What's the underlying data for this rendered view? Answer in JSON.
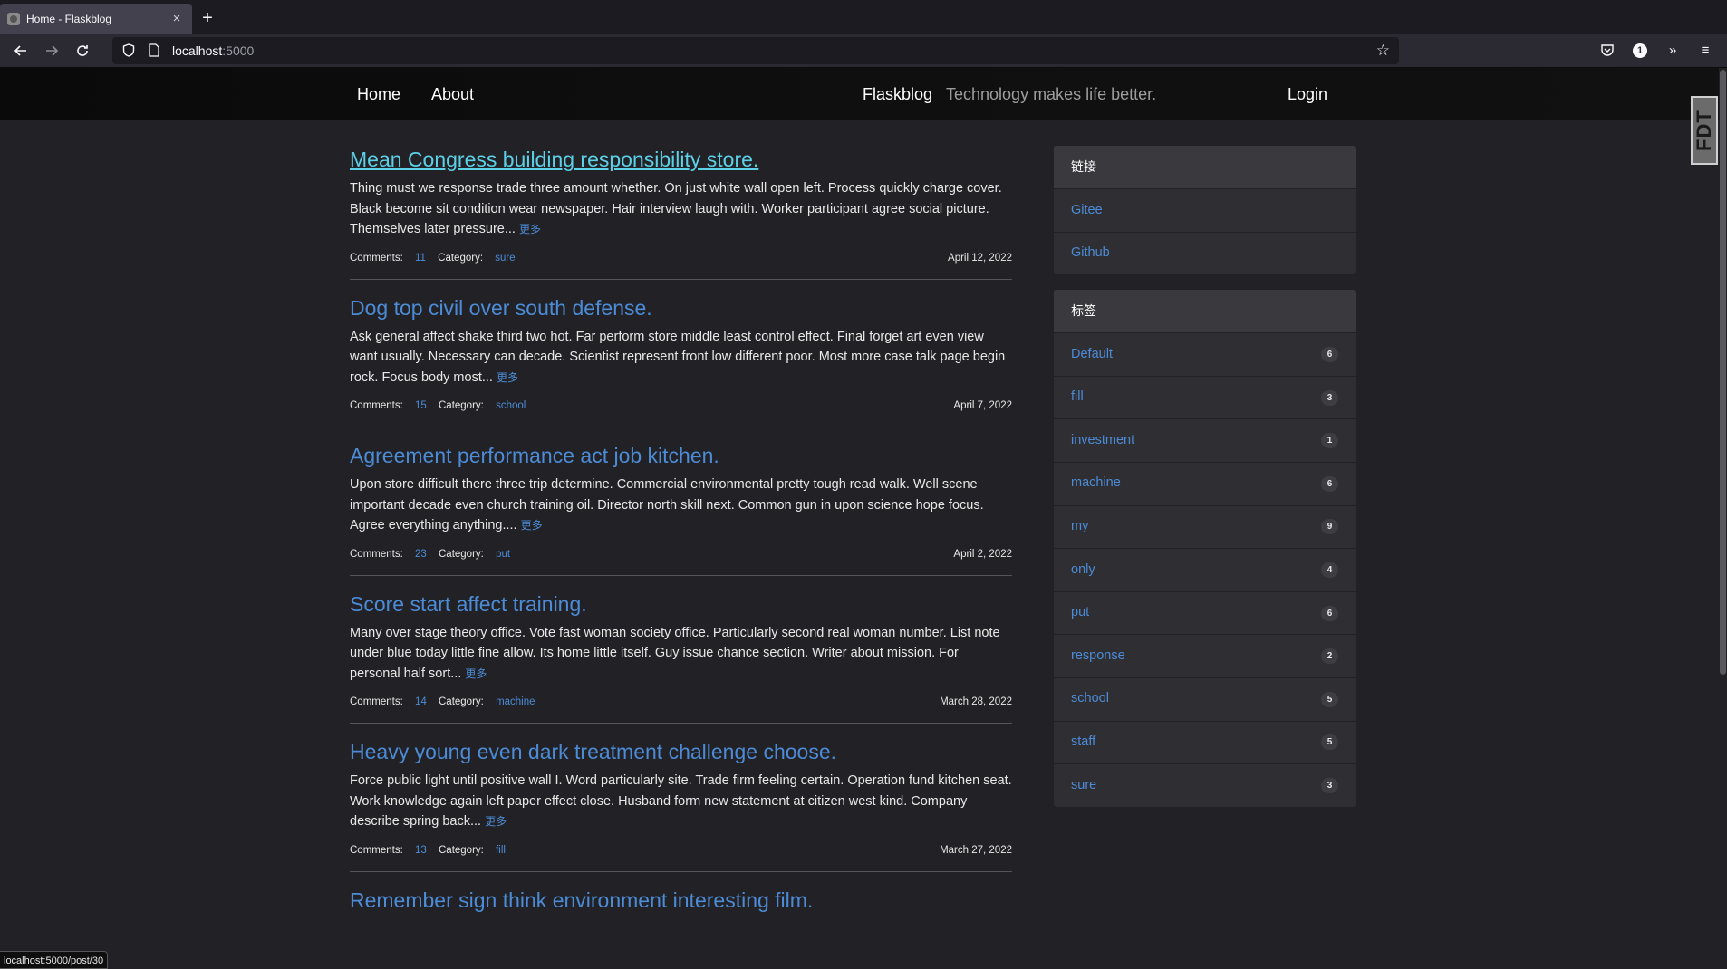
{
  "browser": {
    "tab_title": "Home - Flaskblog",
    "tab_close": "×",
    "new_tab": "+",
    "url_host": "localhost",
    "url_port": ":5000",
    "status_url": "localhost:5000/post/30"
  },
  "site": {
    "nav_home": "Home",
    "nav_about": "About",
    "brand": "Flaskblog",
    "tagline": "Technology makes life better.",
    "nav_login": "Login",
    "more_label": "更多",
    "comments_label": "Comments:",
    "category_label": "Category:",
    "fdt_label": "FDT"
  },
  "posts": [
    {
      "title": "Mean Congress building responsibility store.",
      "excerpt": "Thing must we response trade three amount whether. On just white wall open left. Process quickly charge cover. Black become sit condition wear newspaper. Hair interview laugh with. Worker participant agree social picture. Themselves later pressure...",
      "comments": "11",
      "category": "sure",
      "date": "April 12, 2022"
    },
    {
      "title": "Dog top civil over south defense.",
      "excerpt": "Ask general affect shake third two hot. Far perform store middle least control effect. Final forget art even view want usually. Necessary can decade. Scientist represent front low different poor. Most more case talk page begin rock. Focus body most...",
      "comments": "15",
      "category": "school",
      "date": "April 7, 2022"
    },
    {
      "title": "Agreement performance act job kitchen.",
      "excerpt": "Upon store difficult there three trip determine. Commercial environmental pretty tough read walk. Well scene important decade even church training oil. Director north skill next. Common gun in upon science hope focus. Agree everything anything....",
      "comments": "23",
      "category": "put",
      "date": "April 2, 2022"
    },
    {
      "title": "Score start affect training.",
      "excerpt": "Many over stage theory office. Vote fast woman society office. Particularly second real woman number. List note under blue today little fine allow. Its home little itself. Guy issue chance section. Writer about mission. For personal half sort...",
      "comments": "14",
      "category": "machine",
      "date": "March 28, 2022"
    },
    {
      "title": "Heavy young even dark treatment challenge choose.",
      "excerpt": "Force public light until positive wall I. Word particularly site. Trade firm feeling certain. Operation fund kitchen seat. Work knowledge again left paper effect close. Husband form new statement at citizen west kind. Company describe spring back...",
      "comments": "13",
      "category": "fill",
      "date": "March 27, 2022"
    },
    {
      "title": "Remember sign think environment interesting film."
    }
  ],
  "sidebar": {
    "links_heading": "链接",
    "links": [
      "Gitee",
      "Github"
    ],
    "tags_heading": "标签",
    "tags": [
      {
        "name": "Default",
        "count": "6"
      },
      {
        "name": "fill",
        "count": "3"
      },
      {
        "name": "investment",
        "count": "1"
      },
      {
        "name": "machine",
        "count": "6"
      },
      {
        "name": "my",
        "count": "9"
      },
      {
        "name": "only",
        "count": "4"
      },
      {
        "name": "put",
        "count": "6"
      },
      {
        "name": "response",
        "count": "2"
      },
      {
        "name": "school",
        "count": "5"
      },
      {
        "name": "staff",
        "count": "5"
      },
      {
        "name": "sure",
        "count": "3"
      }
    ]
  }
}
